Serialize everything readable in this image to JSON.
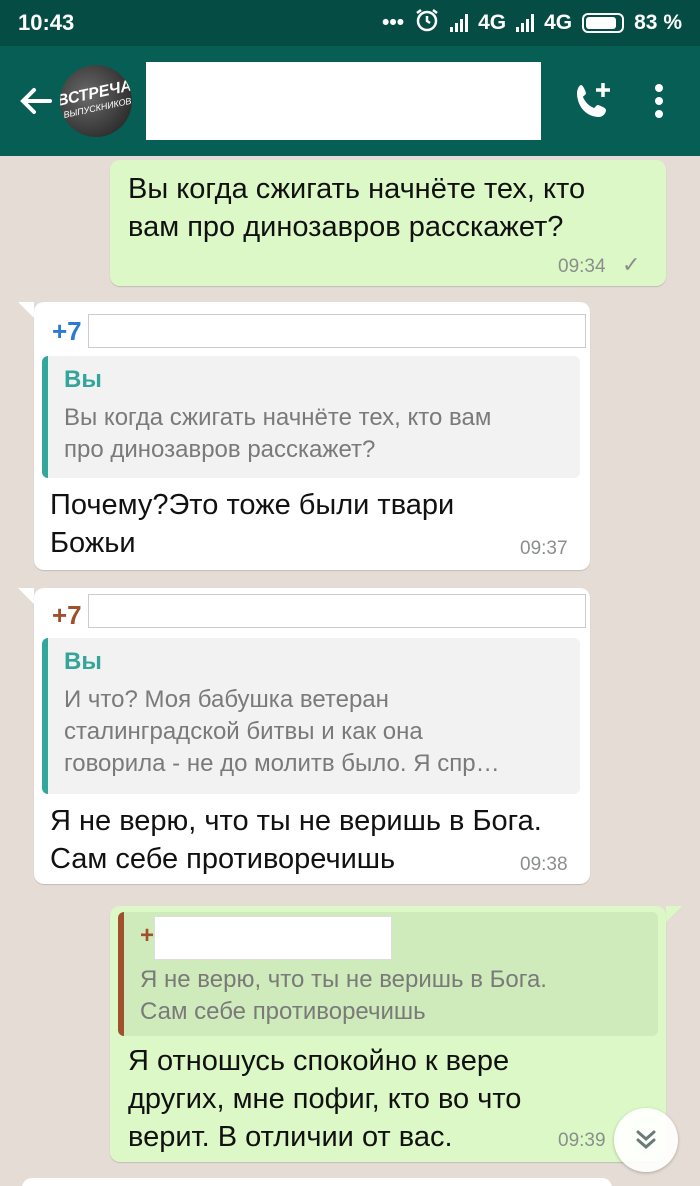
{
  "status_bar": {
    "time": "10:43",
    "dots": "•••",
    "network1": "4G",
    "network2": "4G",
    "battery": "83 %"
  },
  "header": {
    "avatar_line1": "ВСТРЕЧА",
    "avatar_line2": "ВЫПУСКНИКОВ",
    "icons": {
      "back": "arrow-left-icon",
      "call": "add-call-icon",
      "menu": "more-vert-icon"
    }
  },
  "messages": [
    {
      "direction": "out",
      "text_lines": [
        "Вы когда сжигать начнёте тех, кто",
        "вам про динозавров расскажет?"
      ],
      "time": "09:34",
      "check": "✓"
    },
    {
      "direction": "in",
      "sender_prefix": "+7",
      "sender_color": "#2b7bd6",
      "quote_name": "Вы",
      "quote_lines": [
        "Вы когда сжигать начнёте тех, кто вам",
        "про динозавров расскажет?"
      ],
      "text_lines": [
        "Почему?Это тоже были твари",
        "Божьи"
      ],
      "time": "09:37"
    },
    {
      "direction": "in",
      "sender_prefix": "+7",
      "sender_color": "#a0502d",
      "quote_name": "Вы",
      "quote_lines": [
        "И что? Моя бабушка ветеран",
        "сталинградской битвы и как она",
        "говорила - не до молитв было. Я спр…"
      ],
      "text_lines": [
        "Я не верю, что ты не веришь в Бога.",
        "Сам себе противоречишь"
      ],
      "time": "09:38"
    },
    {
      "direction": "out",
      "quote_prefix": "+",
      "quote_border_color": "#a0502d",
      "quote_lines": [
        "Я не верю, что ты не веришь в Бога.",
        "Сам себе противоречишь"
      ],
      "text_lines": [
        "Я отношусь спокойно к вере",
        "других, мне пофиг, кто во что",
        "верит. В отличии от вас."
      ],
      "time": "09:39"
    }
  ],
  "scroll_down_icon": "double-chevron-down-icon",
  "colors": {
    "header": "#075e54",
    "status_bar": "#054d44",
    "outgoing": "#dcf8c6",
    "incoming": "#ffffff",
    "wallpaper": "#e5ddd5",
    "quote_accent": "#34a79c"
  }
}
